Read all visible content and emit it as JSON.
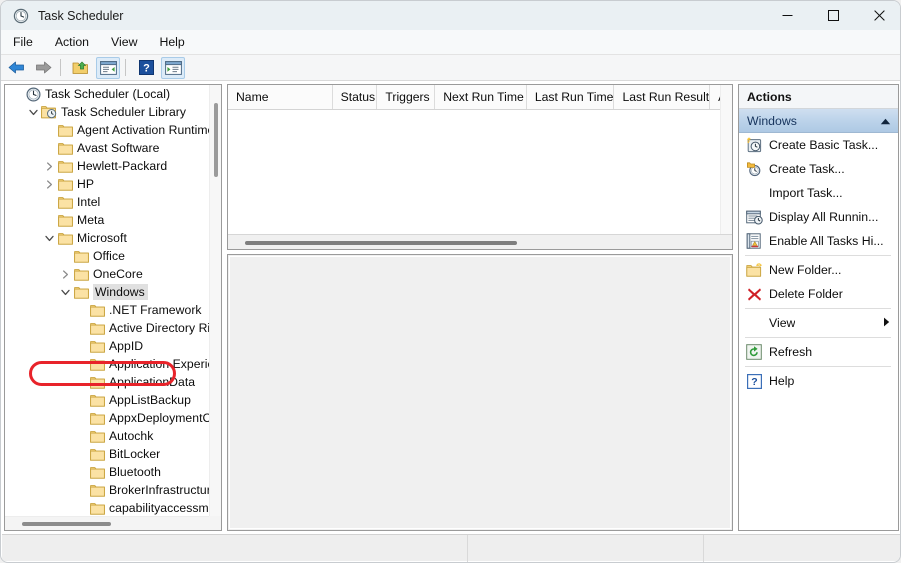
{
  "window": {
    "title": "Task Scheduler",
    "icon": "clock-icon",
    "controls": {
      "minimize": "—",
      "maximize": "☐",
      "close": "✕"
    }
  },
  "menubar": {
    "items": [
      "File",
      "Action",
      "View",
      "Help"
    ]
  },
  "toolbar": {
    "buttons": [
      {
        "name": "back-button",
        "icon": "arrow-left-icon"
      },
      {
        "name": "forward-button",
        "icon": "arrow-right-icon"
      },
      {
        "name": "up-one-level-button",
        "icon": "folder-up-icon"
      },
      {
        "name": "show-hide-console-tree-button",
        "icon": "console-tree-icon"
      },
      {
        "name": "help-button",
        "icon": "question-mark-icon"
      },
      {
        "name": "show-hide-action-pane-button",
        "icon": "action-pane-icon"
      }
    ]
  },
  "tree": {
    "items": [
      {
        "label": "Task Scheduler (Local)",
        "indent": 0,
        "chev": "none",
        "icon": "clock-icon",
        "selected": false
      },
      {
        "label": "Task Scheduler Library",
        "indent": 1,
        "chev": "down",
        "icon": "library-folder-icon",
        "selected": false
      },
      {
        "label": "Agent Activation Runtime",
        "indent": 2,
        "chev": "none",
        "icon": "folder-icon",
        "selected": false
      },
      {
        "label": "Avast Software",
        "indent": 2,
        "chev": "none",
        "icon": "folder-icon",
        "selected": false
      },
      {
        "label": "Hewlett-Packard",
        "indent": 2,
        "chev": "right",
        "icon": "folder-icon",
        "selected": false
      },
      {
        "label": "HP",
        "indent": 2,
        "chev": "right",
        "icon": "folder-icon",
        "selected": false
      },
      {
        "label": "Intel",
        "indent": 2,
        "chev": "none",
        "icon": "folder-icon",
        "selected": false
      },
      {
        "label": "Meta",
        "indent": 2,
        "chev": "none",
        "icon": "folder-icon",
        "selected": false
      },
      {
        "label": "Microsoft",
        "indent": 2,
        "chev": "down",
        "icon": "folder-icon",
        "selected": false
      },
      {
        "label": "Office",
        "indent": 3,
        "chev": "none",
        "icon": "folder-icon",
        "selected": false
      },
      {
        "label": "OneCore",
        "indent": 3,
        "chev": "right",
        "icon": "folder-icon",
        "selected": false
      },
      {
        "label": "Windows",
        "indent": 3,
        "chev": "down",
        "icon": "folder-icon",
        "selected": true
      },
      {
        "label": ".NET Framework",
        "indent": 4,
        "chev": "none",
        "icon": "folder-icon",
        "selected": false
      },
      {
        "label": "Active Directory Rights Management",
        "indent": 4,
        "chev": "none",
        "icon": "folder-icon",
        "selected": false
      },
      {
        "label": "AppID",
        "indent": 4,
        "chev": "none",
        "icon": "folder-icon",
        "selected": false
      },
      {
        "label": "Application Experience",
        "indent": 4,
        "chev": "none",
        "icon": "folder-icon",
        "selected": false
      },
      {
        "label": "ApplicationData",
        "indent": 4,
        "chev": "none",
        "icon": "folder-icon",
        "selected": false
      },
      {
        "label": "AppListBackup",
        "indent": 4,
        "chev": "none",
        "icon": "folder-icon",
        "selected": false
      },
      {
        "label": "AppxDeploymentClient",
        "indent": 4,
        "chev": "none",
        "icon": "folder-icon",
        "selected": false
      },
      {
        "label": "Autochk",
        "indent": 4,
        "chev": "none",
        "icon": "folder-icon",
        "selected": false
      },
      {
        "label": "BitLocker",
        "indent": 4,
        "chev": "none",
        "icon": "folder-icon",
        "selected": false
      },
      {
        "label": "Bluetooth",
        "indent": 4,
        "chev": "none",
        "icon": "folder-icon",
        "selected": false
      },
      {
        "label": "BrokerInfrastructure",
        "indent": 4,
        "chev": "none",
        "icon": "folder-icon",
        "selected": false
      },
      {
        "label": "capabilityaccessmanager",
        "indent": 4,
        "chev": "none",
        "icon": "folder-icon",
        "selected": false
      }
    ],
    "highlight": {
      "target": "Windows",
      "color": "#e8232a"
    }
  },
  "list": {
    "columns": [
      {
        "label": "Name",
        "width": 105
      },
      {
        "label": "Status",
        "width": 45
      },
      {
        "label": "Triggers",
        "width": 58
      },
      {
        "label": "Next Run Time",
        "width": 92
      },
      {
        "label": "Last Run Time",
        "width": 88
      },
      {
        "label": "Last Run Result",
        "width": 96
      },
      {
        "label": "Auth",
        "width": 22
      }
    ],
    "rows": []
  },
  "actions": {
    "title": "Actions",
    "group_label": "Windows",
    "group_collapse_icon": "chevron-up-icon",
    "items": [
      {
        "label": "Create Basic Task...",
        "icon": "create-basic-task-icon",
        "sep_after": false,
        "submenu": false
      },
      {
        "label": "Create Task...",
        "icon": "create-task-icon",
        "sep_after": false,
        "submenu": false
      },
      {
        "label": "Import Task...",
        "icon": "none",
        "sep_after": false,
        "submenu": false
      },
      {
        "label": "Display All Runnin...",
        "icon": "display-running-tasks-icon",
        "sep_after": false,
        "submenu": false
      },
      {
        "label": "Enable All Tasks Hi...",
        "icon": "enable-all-tasks-history-icon",
        "sep_after": true,
        "submenu": false
      },
      {
        "label": "New Folder...",
        "icon": "new-folder-icon",
        "sep_after": false,
        "submenu": false
      },
      {
        "label": "Delete Folder",
        "icon": "delete-folder-icon",
        "sep_after": true,
        "submenu": false
      },
      {
        "label": "View",
        "icon": "none",
        "sep_after": true,
        "submenu": true
      },
      {
        "label": "Refresh",
        "icon": "refresh-icon",
        "sep_after": true,
        "submenu": false
      },
      {
        "label": "Help",
        "icon": "help-icon",
        "sep_after": false,
        "submenu": false
      }
    ]
  },
  "statusbar": {
    "main": "",
    "segment1": "",
    "segment2": ""
  }
}
